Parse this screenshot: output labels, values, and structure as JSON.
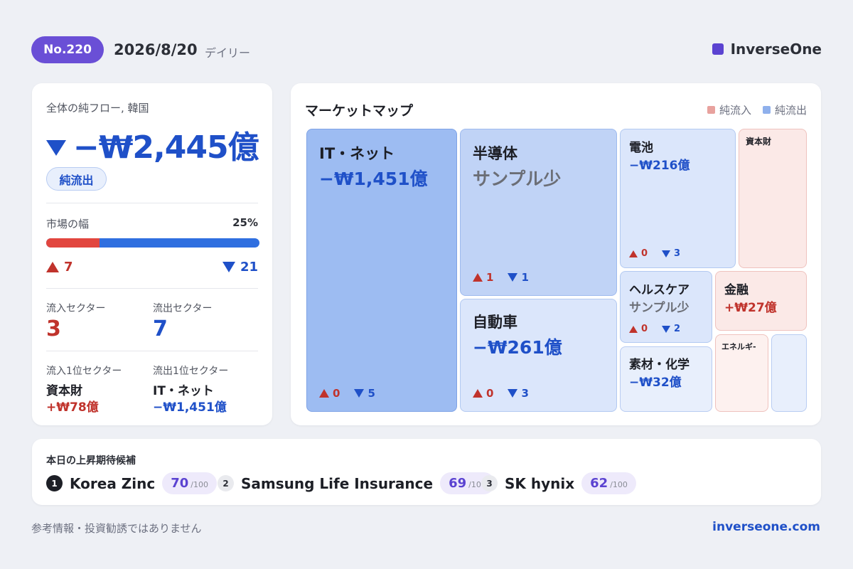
{
  "header": {
    "issue": "No.220",
    "date": "2026/8/20",
    "period": "デイリー",
    "brand": "InverseOne"
  },
  "summary": {
    "label": "全体の純フロー, 韓国",
    "value": "−₩2,445億",
    "direction_badge": "純流出",
    "breadth_label": "市場の幅",
    "breadth_pct": "25%",
    "breadth_fraction": 0.25,
    "up_count": "7",
    "down_count": "21",
    "inflow_sectors_label": "流入セクター",
    "inflow_sectors": "3",
    "outflow_sectors_label": "流出セクター",
    "outflow_sectors": "7",
    "top_inflow_label": "流入1位セクター",
    "top_inflow_name": "資本財",
    "top_inflow_value": "+₩78億",
    "top_outflow_label": "流出1位セクター",
    "top_outflow_name": "IT・ネット",
    "top_outflow_value": "−₩1,451億"
  },
  "market_map": {
    "title": "マーケットマップ",
    "legend_in": "純流入",
    "legend_out": "純流出",
    "colors": {
      "in": "#e8a29e",
      "out": "#8fb0ec"
    },
    "tiles": [
      {
        "name": "IT・ネット",
        "value": "−₩1,451億",
        "up": "0",
        "down": "5"
      },
      {
        "name": "半導体",
        "value": "サンプル少",
        "up": "1",
        "down": "1"
      },
      {
        "name": "自動車",
        "value": "−₩261億",
        "up": "0",
        "down": "3"
      },
      {
        "name": "電池",
        "value": "−₩216億",
        "up": "0",
        "down": "3"
      },
      {
        "name": "資本財"
      },
      {
        "name": "ヘルスケア",
        "value": "サンプル少",
        "up": "0",
        "down": "2"
      },
      {
        "name": "金融",
        "value": "+₩27億"
      },
      {
        "name": "素材・化学",
        "value": "−₩32億"
      },
      {
        "name": "エネルギ‐"
      }
    ]
  },
  "candidates": {
    "title": "本日の上昇期待候補",
    "items": [
      {
        "rank": "1",
        "name": "Korea Zinc",
        "score": "70",
        "denom": "/100"
      },
      {
        "rank": "2",
        "name": "Samsung Life Insurance",
        "score": "69",
        "denom": "/100"
      },
      {
        "rank": "3",
        "name": "SK hynix",
        "score": "62",
        "denom": "/100"
      }
    ]
  },
  "footer": {
    "disclaimer": "参考情報・投資勧誘ではありません",
    "site": "inverseone.com"
  }
}
